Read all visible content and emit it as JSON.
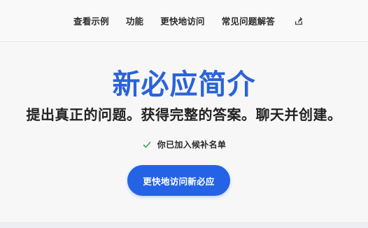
{
  "nav": {
    "items": [
      {
        "label": "查看示例"
      },
      {
        "label": "功能"
      },
      {
        "label": "更快地访问"
      },
      {
        "label": "常见问题解答"
      }
    ],
    "share_icon": "share-icon"
  },
  "hero": {
    "title": "新必应简介",
    "subtitle": "提出真正的问题。获得完整的答案。聊天并创建。",
    "waitlist_status": "你已加入候补名单",
    "waitlist_icon": "check-icon",
    "cta_label": "更快地访问新必应"
  },
  "colors": {
    "accent": "#2563e6",
    "title": "#2a63d8",
    "check": "#3aa657"
  }
}
